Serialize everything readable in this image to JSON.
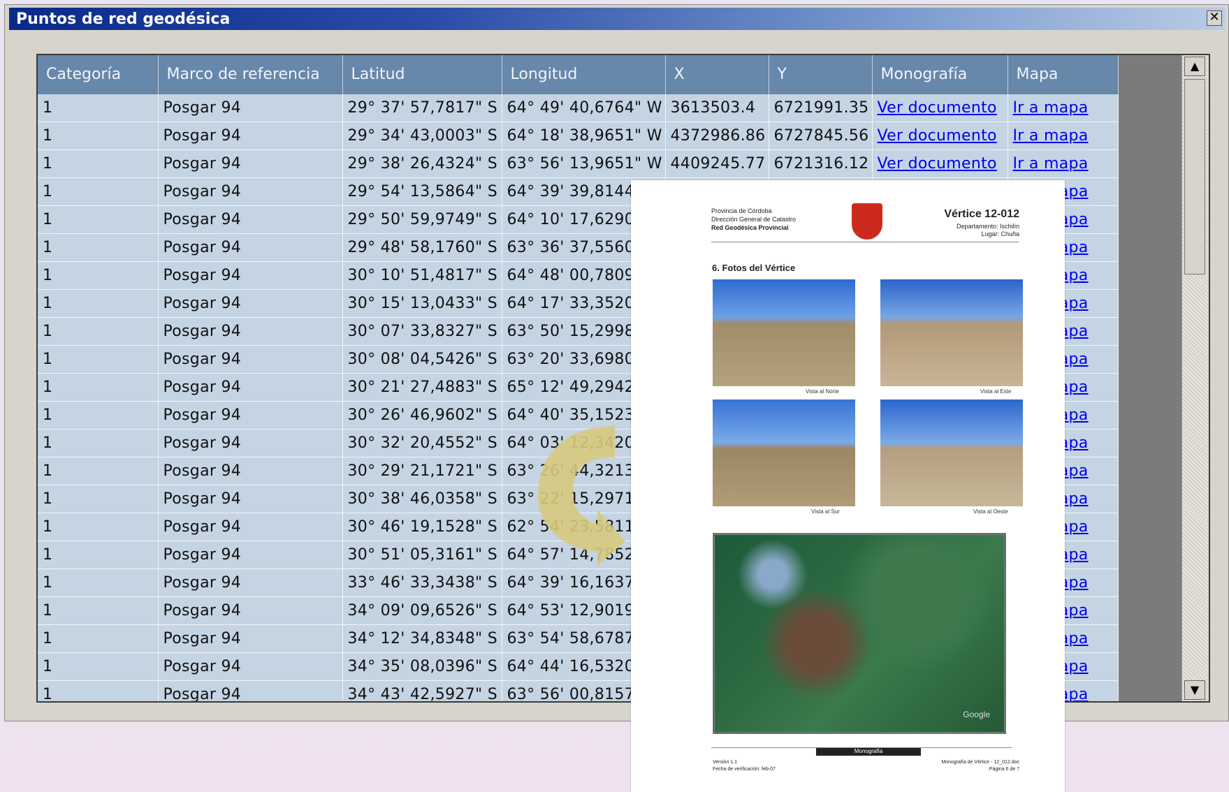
{
  "window": {
    "title": "Puntos de red geodésica",
    "close": "✕"
  },
  "grid": {
    "headers": [
      "Categoría",
      "Marco de referencia",
      "Latitud",
      "Longitud",
      "X",
      "Y",
      "Monografía",
      "Mapa"
    ],
    "rows": [
      [
        "1",
        "Posgar 94",
        "29° 37' 57,7817\" S",
        "64° 49' 40,6764\" W",
        "3613503.4",
        "6721991.35",
        "Ver documento",
        "Ir a mapa"
      ],
      [
        "1",
        "Posgar 94",
        "29° 34' 43,0003\" S",
        "64° 18' 38,9651\" W",
        "4372986.86",
        "6727845.56",
        "Ver documento",
        "Ir a mapa"
      ],
      [
        "1",
        "Posgar 94",
        "29° 38' 26,4324\" S",
        "63° 56' 13,9651\" W",
        "4409245.77",
        "6721316.12",
        "Ver documento",
        "Ir a mapa"
      ],
      [
        "1",
        "Posgar 94",
        "29° 54' 13,5864\" S",
        "64° 39' 39,8144",
        "",
        "",
        "",
        "Ir a mapa"
      ],
      [
        "1",
        "Posgar 94",
        "29° 50' 59,9749\" S",
        "64° 10' 17,6290",
        "",
        "",
        "",
        "Ir a mapa"
      ],
      [
        "1",
        "Posgar 94",
        "29° 48' 58,1760\" S",
        "63° 36' 37,5560",
        "",
        "",
        "",
        "Ir a mapa"
      ],
      [
        "1",
        "Posgar 94",
        "30° 10' 51,4817\" S",
        "64° 48' 00,7809",
        "",
        "",
        "",
        "Ir a mapa"
      ],
      [
        "1",
        "Posgar 94",
        "30° 15' 13,0433\" S",
        "64° 17' 33,3520",
        "",
        "",
        "",
        "Ir a mapa"
      ],
      [
        "1",
        "Posgar 94",
        "30° 07' 33,8327\" S",
        "63° 50' 15,2998",
        "",
        "",
        "",
        "Ir a mapa"
      ],
      [
        "1",
        "Posgar 94",
        "30° 08' 04,5426\" S",
        "63° 20' 33,6980",
        "",
        "",
        "",
        "Ir a mapa"
      ],
      [
        "1",
        "Posgar 94",
        "30° 21' 27,4883\" S",
        "65° 12' 49,2942",
        "",
        "",
        "",
        "Ir a mapa"
      ],
      [
        "1",
        "Posgar 94",
        "30° 26' 46,9602\" S",
        "64° 40' 35,1523",
        "",
        "",
        "",
        "Ir a mapa"
      ],
      [
        "1",
        "Posgar 94",
        "30° 32' 20,4552\" S",
        "64° 03' 12,3420",
        "",
        "",
        "",
        "Ir a mapa"
      ],
      [
        "1",
        "Posgar 94",
        "30° 29' 21,1721\" S",
        "63° 26' 44,3213",
        "",
        "",
        "",
        "Ir a mapa"
      ],
      [
        "1",
        "Posgar 94",
        "30° 38' 46,0358\" S",
        "63° 22' 15,2971",
        "",
        "",
        "",
        "Ir a mapa"
      ],
      [
        "1",
        "Posgar 94",
        "30° 46' 19,1528\" S",
        "62° 54' 23,5811",
        "",
        "",
        "",
        "Ir a mapa"
      ],
      [
        "1",
        "Posgar 94",
        "30° 51' 05,3161\" S",
        "64° 57' 14,7852",
        "",
        "",
        "",
        "Ir a mapa"
      ],
      [
        "1",
        "Posgar 94",
        "33° 46' 33,3438\" S",
        "64° 39' 16,1637",
        "",
        "",
        "",
        "Ir a mapa"
      ],
      [
        "1",
        "Posgar 94",
        "34° 09' 09,6526\" S",
        "64° 53' 12,9019",
        "",
        "",
        "",
        "Ir a mapa"
      ],
      [
        "1",
        "Posgar 94",
        "34° 12' 34,8348\" S",
        "63° 54' 58,6787",
        "",
        "",
        "",
        "Ir a mapa"
      ],
      [
        "1",
        "Posgar 94",
        "34° 35' 08,0396\" S",
        "64° 44' 16,5320",
        "",
        "",
        "",
        "Ir a mapa"
      ],
      [
        "1",
        "Posgar 94",
        "34° 43' 42,5927\" S",
        "63° 56' 00,8157",
        "",
        "",
        "",
        "Ir a mapa"
      ]
    ]
  },
  "scrollbar": {
    "up": "▲",
    "down": "▼"
  },
  "document": {
    "org_line1": "Provincia de Córdoba",
    "org_line2": "Dirección General de Catastro",
    "org_line3": "Red Geodésica Provincial",
    "title": "Vértice 12-012",
    "dept": "Departamento: Ischilín",
    "place": "Lugar: Chuña",
    "section": "6.    Fotos del Vértice",
    "captions": [
      "Vista al Norte",
      "Vista al Este",
      "Vista al Sur",
      "Vista al Oeste"
    ],
    "map_label": "Monografía",
    "footer_left1": "Versión 1.1",
    "footer_left2": "Fecha de verificación: feb-07",
    "footer_right1": "Monografía de Vértice - 12_012.doc",
    "footer_right2": "Página 6 de 7",
    "map_watermark": "Google"
  },
  "colors": {
    "header": "#6787ab",
    "cell": "#c4d4e3",
    "link": "#0000ee",
    "arrow": "#d8c97e"
  }
}
